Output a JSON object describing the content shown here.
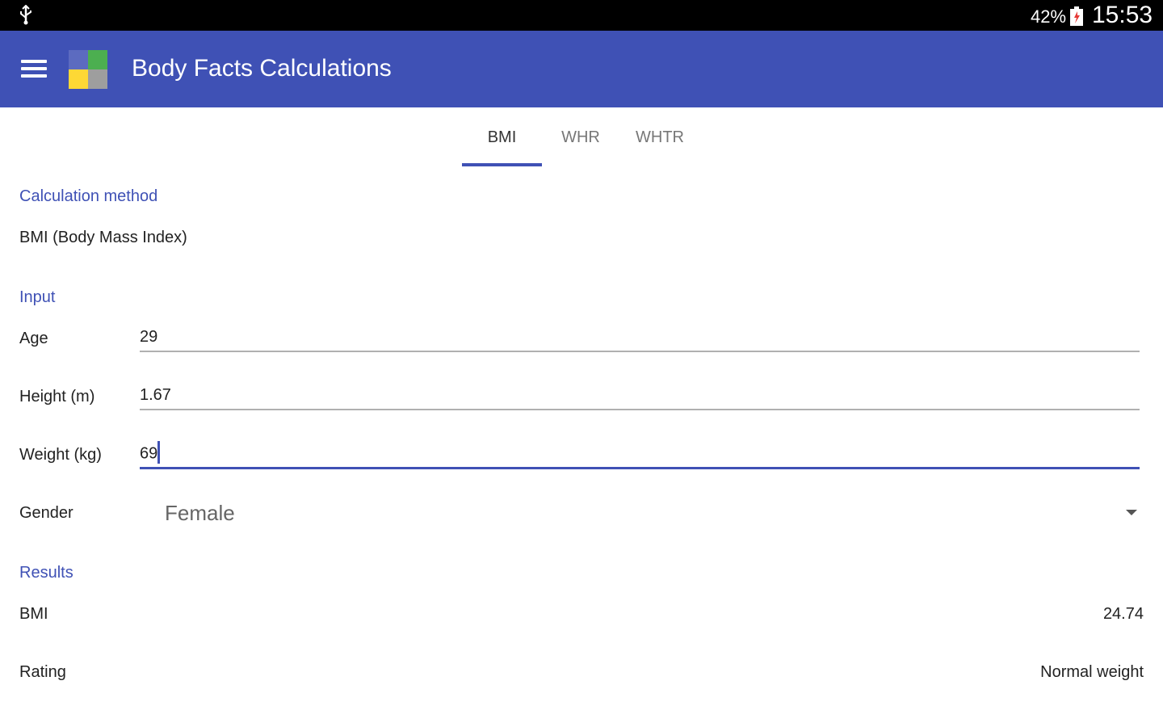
{
  "status_bar": {
    "usb_icon": "usb-icon",
    "battery_percent": "42%",
    "battery_icon": "battery-icon",
    "clock": "15:53"
  },
  "app_bar": {
    "menu_icon": "menu-icon",
    "logo_icon": "app-logo-icon",
    "title": "Body Facts Calculations",
    "color": "#3f51b5"
  },
  "tabs": [
    {
      "label": "BMI",
      "active": true
    },
    {
      "label": "WHR",
      "active": false
    },
    {
      "label": "WHTR",
      "active": false
    }
  ],
  "calculation_method": {
    "title": "Calculation method",
    "value": "BMI (Body Mass Index)"
  },
  "input": {
    "title": "Input",
    "age": {
      "label": "Age",
      "value": "29"
    },
    "height": {
      "label": "Height (m)",
      "value": "1.67"
    },
    "weight": {
      "label": "Weight (kg)",
      "value": "69"
    },
    "gender": {
      "label": "Gender",
      "selected": "Female"
    }
  },
  "results": {
    "title": "Results",
    "bmi": {
      "label": "BMI",
      "value": "24.74"
    },
    "rating": {
      "label": "Rating",
      "value": "Normal weight"
    }
  },
  "accent_color": "#3f51b5"
}
